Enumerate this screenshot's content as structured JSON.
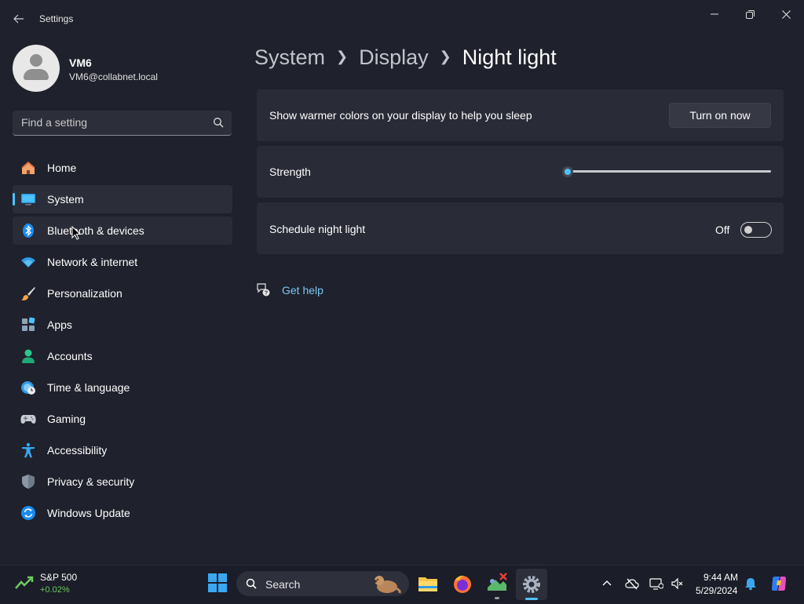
{
  "window": {
    "title": "Settings",
    "controls": {
      "minimize": "minimize",
      "restore": "restore",
      "close": "close"
    }
  },
  "user": {
    "name": "VM6",
    "email": "VM6@collabnet.local"
  },
  "search": {
    "placeholder": "Find a setting"
  },
  "nav": {
    "items": [
      {
        "label": "Home",
        "icon": "home-icon"
      },
      {
        "label": "System",
        "icon": "system-icon",
        "selected": true
      },
      {
        "label": "Bluetooth & devices",
        "icon": "bluetooth-icon",
        "hover": true
      },
      {
        "label": "Network & internet",
        "icon": "wifi-icon"
      },
      {
        "label": "Personalization",
        "icon": "brush-icon"
      },
      {
        "label": "Apps",
        "icon": "apps-icon"
      },
      {
        "label": "Accounts",
        "icon": "accounts-icon"
      },
      {
        "label": "Time & language",
        "icon": "globe-clock-icon"
      },
      {
        "label": "Gaming",
        "icon": "gamepad-icon"
      },
      {
        "label": "Accessibility",
        "icon": "accessibility-icon"
      },
      {
        "label": "Privacy & security",
        "icon": "shield-icon"
      },
      {
        "label": "Windows Update",
        "icon": "update-icon"
      }
    ]
  },
  "breadcrumb": {
    "level1": "System",
    "level2": "Display",
    "current": "Night light"
  },
  "cards": {
    "warm_colors": {
      "text": "Show warmer colors on your display to help you sleep",
      "button": "Turn on now"
    },
    "strength": {
      "label": "Strength",
      "value_fraction": 0.0
    },
    "schedule": {
      "label": "Schedule night light",
      "toggle_state": "Off",
      "on": false
    }
  },
  "help": {
    "label": "Get help"
  },
  "taskbar": {
    "widget": {
      "title": "S&P 500",
      "change": "+0.02%"
    },
    "search_label": "Search",
    "apps": [
      "file-explorer-icon",
      "firefox-icon",
      "snipping-tool-icon",
      "settings-icon"
    ],
    "tray": [
      "chevron-up-icon",
      "cloud-off-icon",
      "display-icon",
      "speaker-muted-icon",
      "bell-icon",
      "copilot-icon"
    ],
    "time": "9:44 AM",
    "date": "5/29/2024"
  }
}
